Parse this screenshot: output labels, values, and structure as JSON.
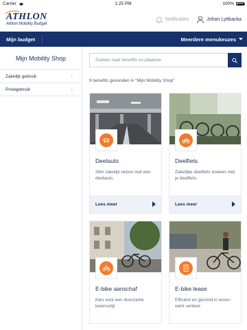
{
  "status_bar": {
    "carrier": "Carrier",
    "time": "1:25 PM",
    "battery": "100%",
    "battery_level": 1.0
  },
  "header": {
    "logo_text": "ATHLON",
    "logo_subtitle": "Athlon Mobility Budget",
    "notifications_label": "Notificaties",
    "user_name": "Johan Lyttbacka"
  },
  "nav": {
    "home_label": "Mijn budget",
    "more_menu_label": "Meerdere menukeuzes"
  },
  "sidebar": {
    "title": "Mijn Mobility Shop",
    "items": [
      {
        "label": "Zakelijk gebruik"
      },
      {
        "label": "Privégebruik"
      }
    ]
  },
  "search": {
    "placeholder": "Zoeken naar benefits en plaatsen"
  },
  "results_text": "9 benefits gevonden in \"Mijn Mobility Shop\"",
  "cards": [
    {
      "title": "Deelauto",
      "description": "Slim zakelijk reizen met een deelauto.",
      "link_label": "Lees meer",
      "icon": "car-share-icon"
    },
    {
      "title": "Deelfiets",
      "description": "Zakelijke deelfiets boeken met je deelfiets.",
      "link_label": "Lees meer",
      "icon": "bike-share-icon"
    },
    {
      "title": "E-bike aanschaf",
      "description": "Kies voor een duurzame levensstijl",
      "link_label": "",
      "icon": "ebike-purchase-icon"
    },
    {
      "title": "E-bike lease",
      "description": "Efficiënt en gezond in woon-werk verkeer.",
      "link_label": "",
      "icon": "ebike-lease-icon"
    }
  ],
  "colors": {
    "primary": "#16316b",
    "accent": "#f07b2c",
    "logo_gold": "#e7a82a",
    "card_footer": "#eef2f8"
  }
}
